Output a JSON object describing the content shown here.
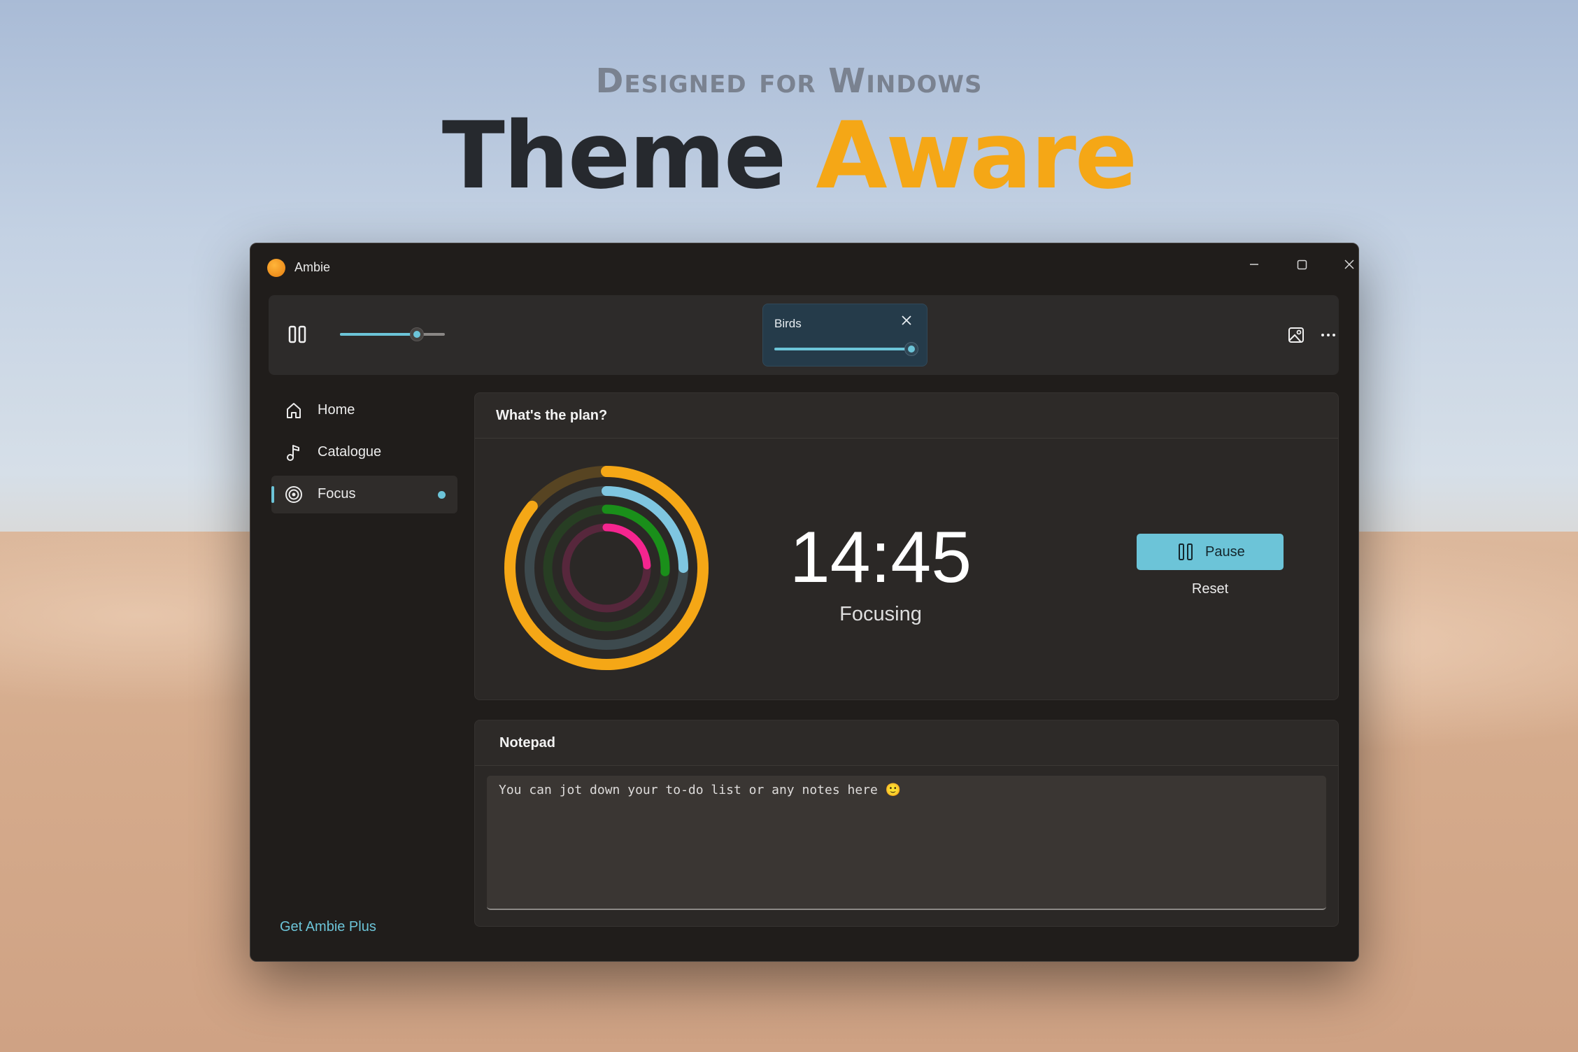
{
  "hero": {
    "subtitle": "Designed for Windows",
    "title_part1": "Theme",
    "title_part2": "Aware"
  },
  "window": {
    "app_name": "Ambie",
    "controls": [
      "minimize-icon",
      "maximize-icon",
      "close-icon"
    ]
  },
  "toolbar": {
    "play_state_icon": "pause-icon",
    "master_volume": 0.73,
    "active_sound": {
      "label": "Birds",
      "volume": 1.0
    },
    "right_icons": [
      "wallpaper-icon",
      "more-icon"
    ]
  },
  "nav": {
    "items": [
      {
        "label": "Home",
        "icon": "home-icon",
        "active": false
      },
      {
        "label": "Catalogue",
        "icon": "music-note-icon",
        "active": false
      },
      {
        "label": "Focus",
        "icon": "target-icon",
        "active": true
      }
    ],
    "footer_link": "Get Ambie Plus"
  },
  "focus": {
    "card_title": "What's the plan?",
    "time": "14:45",
    "status": "Focusing",
    "pause_label": "Pause",
    "reset_label": "Reset",
    "rings": [
      {
        "name": "outer",
        "color": "#f5a716",
        "progress": 0.86
      },
      {
        "name": "second",
        "color": "#7fc6e0",
        "progress": 0.25
      },
      {
        "name": "third",
        "color": "#1a8f1a",
        "progress": 0.26
      },
      {
        "name": "inner",
        "color": "#f5258f",
        "progress": 0.24
      }
    ]
  },
  "notepad": {
    "card_title": "Notepad",
    "text": "You can jot down your to-do list or any notes here 🙂"
  },
  "colors": {
    "accent": "#6cc4d8",
    "window_bg": "#201d1b",
    "card_bg": "#2d2a28",
    "orange": "#f5a716"
  }
}
